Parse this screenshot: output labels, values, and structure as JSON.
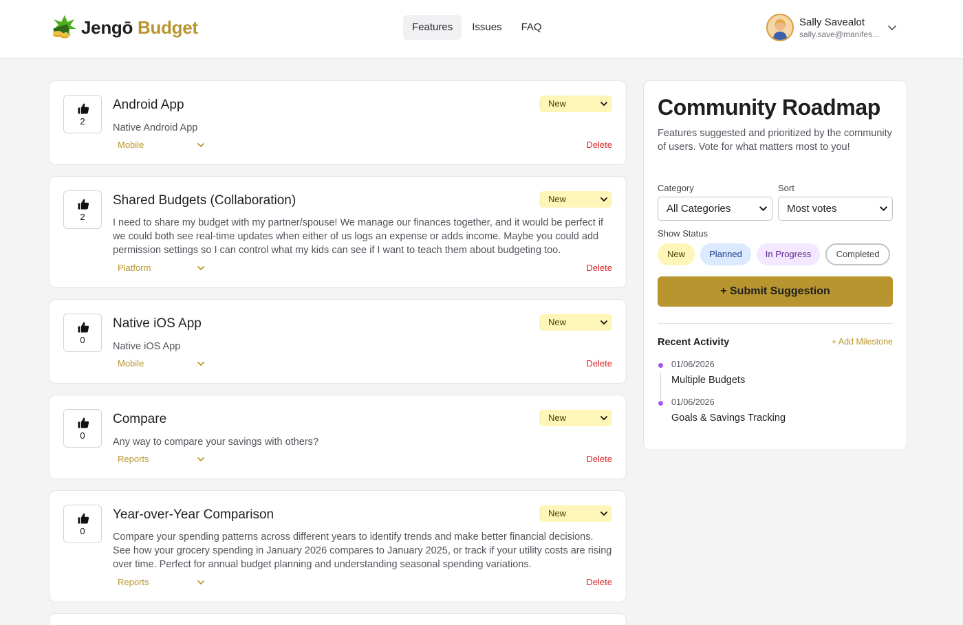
{
  "header": {
    "logo_word1": "Jengō",
    "logo_word2": "Budget",
    "nav": [
      {
        "label": "Features",
        "active": true
      },
      {
        "label": "Issues",
        "active": false
      },
      {
        "label": "FAQ",
        "active": false
      }
    ],
    "user": {
      "name": "Sally Savealot",
      "email": "sally.save@manifes..."
    }
  },
  "features": [
    {
      "votes": "2",
      "title": "Android App",
      "description": "Native Android App",
      "status": "New",
      "category": "Mobile",
      "delete_label": "Delete"
    },
    {
      "votes": "2",
      "title": "Shared Budgets (Collaboration)",
      "description": "I need to share my budget with my partner/spouse! We manage our finances together, and it would be perfect if we could both see real-time updates when either of us logs an expense or adds income. Maybe you could add permission settings so I can control what my kids can see if I want to teach them about budgeting too.",
      "status": "New",
      "category": "Platform",
      "delete_label": "Delete"
    },
    {
      "votes": "0",
      "title": "Native iOS App",
      "description": "Native iOS App",
      "status": "New",
      "category": "Mobile",
      "delete_label": "Delete"
    },
    {
      "votes": "0",
      "title": "Compare",
      "description": "Any way to compare your savings with others?",
      "status": "New",
      "category": "Reports",
      "delete_label": "Delete"
    },
    {
      "votes": "0",
      "title": "Year-over-Year Comparison",
      "description": "Compare your spending patterns across different years to identify trends and make better financial decisions. See how your grocery spending in January 2026 compares to January 2025, or track if your utility costs are rising over time. Perfect for annual budget planning and understanding seasonal spending variations.",
      "status": "New",
      "category": "Reports",
      "delete_label": "Delete"
    }
  ],
  "sidebar": {
    "title": "Community Roadmap",
    "description": "Features suggested and prioritized by the community of users. Vote for what matters most to you!",
    "category_label": "Category",
    "category_value": "All Categories",
    "sort_label": "Sort",
    "sort_value": "Most votes",
    "status_label": "Show Status",
    "statuses": [
      {
        "label": "New",
        "bg": "#fef5b8",
        "color": "#4a3b00"
      },
      {
        "label": "Planned",
        "bg": "#dbeafe",
        "color": "#1e3a8a"
      },
      {
        "label": "In Progress",
        "bg": "#f3e8ff",
        "color": "#581c87"
      },
      {
        "label": "Completed",
        "bg": "#ffffff",
        "color": "#3f3f46"
      }
    ],
    "submit_label": "+ Submit Suggestion",
    "recent_title": "Recent Activity",
    "add_milestone": "+ Add Milestone",
    "activity": [
      {
        "date": "01/06/2026",
        "name": "Multiple Budgets"
      },
      {
        "date": "01/06/2026",
        "name": "Goals & Savings Tracking"
      }
    ]
  },
  "colors": {
    "accent": "#b8952e",
    "danger": "#dc2626",
    "timeline_dot": "#a855f7"
  }
}
